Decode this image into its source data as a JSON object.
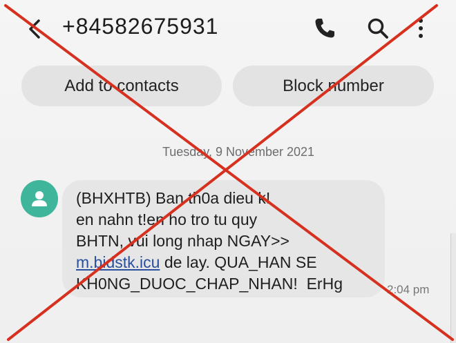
{
  "header": {
    "title": "+84582675931",
    "back_icon": "back-arrow-icon",
    "phone_icon": "phone-icon",
    "search_icon": "search-icon",
    "menu_icon": "more-vert-icon"
  },
  "actions": {
    "add_contacts": "Add to contacts",
    "block_number": "Block number"
  },
  "conversation": {
    "date": "Tuesday, 9 November 2021",
    "message": {
      "lines": [
        "(BHXHTB) Ban th0a dieu k!",
        "en nahn t!en ho tro tu quy",
        "BHTN, vui long nhap NGAY>>"
      ],
      "link_text": "m.bidstk.icu",
      "line4_rest": " de lay. QUA_HAN SE",
      "line5": "KH0NG_DUOC_CHAP_NHAN!  ErHg"
    },
    "time": "2:04 pm"
  },
  "colors": {
    "avatar": "#3fb59c",
    "cross": "#d6301f",
    "link": "#2a4f9c"
  }
}
